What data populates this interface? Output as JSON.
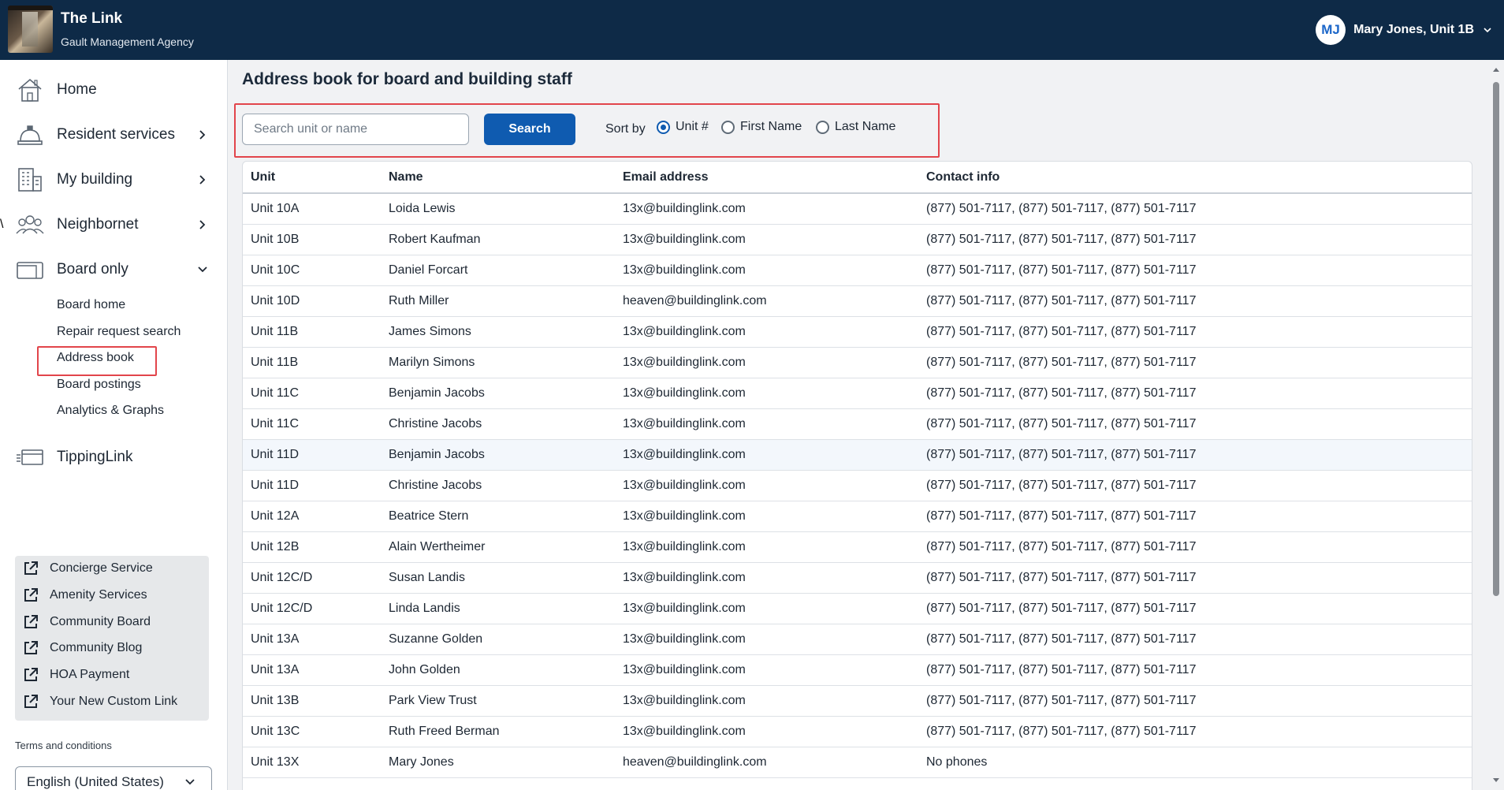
{
  "header": {
    "title": "The Link",
    "subtitle": "Gault Management Agency",
    "user_initials": "MJ",
    "user_name": "Mary Jones, Unit 1B"
  },
  "sidebar": {
    "items": [
      {
        "label": "Home",
        "icon": "home-icon"
      },
      {
        "label": "Resident services",
        "icon": "concierge-bell-icon"
      },
      {
        "label": "My building",
        "icon": "building-icon"
      },
      {
        "label": "Neighbornet",
        "icon": "people-icon"
      },
      {
        "label": "Board only",
        "icon": "wallet-icon"
      },
      {
        "label": "TippingLink",
        "icon": "tipping-icon"
      }
    ],
    "board_subitems": [
      "Board home",
      "Repair request search",
      "Address book",
      "Board postings",
      "Analytics & Graphs"
    ],
    "external_links": [
      "Concierge Service",
      "Amenity Services",
      "Community Board",
      "Community Blog",
      "HOA Payment",
      "Your New Custom Link"
    ],
    "terms": "Terms and conditions",
    "language": "English (United States)"
  },
  "main": {
    "title": "Address book for board and building staff",
    "search_placeholder": "Search unit or name",
    "search_button": "Search",
    "sort_label": "Sort by",
    "sort_options": [
      "Unit #",
      "First Name",
      "Last Name"
    ],
    "sort_selected": "Unit #",
    "columns": [
      "Unit",
      "Name",
      "Email address",
      "Contact info"
    ],
    "rows": [
      {
        "unit": "Unit 10A",
        "name": "Loida Lewis",
        "email": "13x@buildinglink.com",
        "contact": "(877) 501-7117, (877) 501-7117, (877) 501-7117"
      },
      {
        "unit": "Unit 10B",
        "name": "Robert Kaufman",
        "email": "13x@buildinglink.com",
        "contact": "(877) 501-7117, (877) 501-7117, (877) 501-7117"
      },
      {
        "unit": "Unit 10C",
        "name": "Daniel Forcart",
        "email": "13x@buildinglink.com",
        "contact": "(877) 501-7117, (877) 501-7117, (877) 501-7117"
      },
      {
        "unit": "Unit 10D",
        "name": "Ruth Miller",
        "email": "heaven@buildinglink.com",
        "contact": "(877) 501-7117, (877) 501-7117, (877) 501-7117"
      },
      {
        "unit": "Unit 11B",
        "name": "James Simons",
        "email": "13x@buildinglink.com",
        "contact": "(877) 501-7117, (877) 501-7117, (877) 501-7117"
      },
      {
        "unit": "Unit 11B",
        "name": "Marilyn Simons",
        "email": "13x@buildinglink.com",
        "contact": "(877) 501-7117, (877) 501-7117, (877) 501-7117"
      },
      {
        "unit": "Unit 11C",
        "name": "Benjamin Jacobs",
        "email": "13x@buildinglink.com",
        "contact": "(877) 501-7117, (877) 501-7117, (877) 501-7117"
      },
      {
        "unit": "Unit 11C",
        "name": "Christine Jacobs",
        "email": "13x@buildinglink.com",
        "contact": "(877) 501-7117, (877) 501-7117, (877) 501-7117"
      },
      {
        "unit": "Unit 11D",
        "name": "Benjamin Jacobs",
        "email": "13x@buildinglink.com",
        "contact": "(877) 501-7117, (877) 501-7117, (877) 501-7117"
      },
      {
        "unit": "Unit 11D",
        "name": "Christine Jacobs",
        "email": "13x@buildinglink.com",
        "contact": "(877) 501-7117, (877) 501-7117, (877) 501-7117"
      },
      {
        "unit": "Unit 12A",
        "name": "Beatrice Stern",
        "email": "13x@buildinglink.com",
        "contact": "(877) 501-7117, (877) 501-7117, (877) 501-7117"
      },
      {
        "unit": "Unit 12B",
        "name": "Alain Wertheimer",
        "email": "13x@buildinglink.com",
        "contact": "(877) 501-7117, (877) 501-7117, (877) 501-7117"
      },
      {
        "unit": "Unit 12C/D",
        "name": "Susan Landis",
        "email": "13x@buildinglink.com",
        "contact": "(877) 501-7117, (877) 501-7117, (877) 501-7117"
      },
      {
        "unit": "Unit 12C/D",
        "name": "Linda Landis",
        "email": "13x@buildinglink.com",
        "contact": "(877) 501-7117, (877) 501-7117, (877) 501-7117"
      },
      {
        "unit": "Unit 13A",
        "name": "Suzanne Golden",
        "email": "13x@buildinglink.com",
        "contact": "(877) 501-7117, (877) 501-7117, (877) 501-7117"
      },
      {
        "unit": "Unit 13A",
        "name": "John Golden",
        "email": "13x@buildinglink.com",
        "contact": "(877) 501-7117, (877) 501-7117, (877) 501-7117"
      },
      {
        "unit": "Unit 13B",
        "name": "Park View Trust",
        "email": "13x@buildinglink.com",
        "contact": "(877) 501-7117, (877) 501-7117, (877) 501-7117"
      },
      {
        "unit": "Unit 13C",
        "name": "Ruth Freed Berman",
        "email": "13x@buildinglink.com",
        "contact": "(877) 501-7117, (877) 501-7117, (877) 501-7117"
      },
      {
        "unit": "Unit 13X",
        "name": "Mary Jones",
        "email": "heaven@buildinglink.com",
        "contact": "No phones"
      }
    ]
  },
  "colors": {
    "header_bg": "#0e2a47",
    "accent": "#0f5bb0",
    "highlight": "#e2454b",
    "panel_bg": "#f1f2f4"
  }
}
